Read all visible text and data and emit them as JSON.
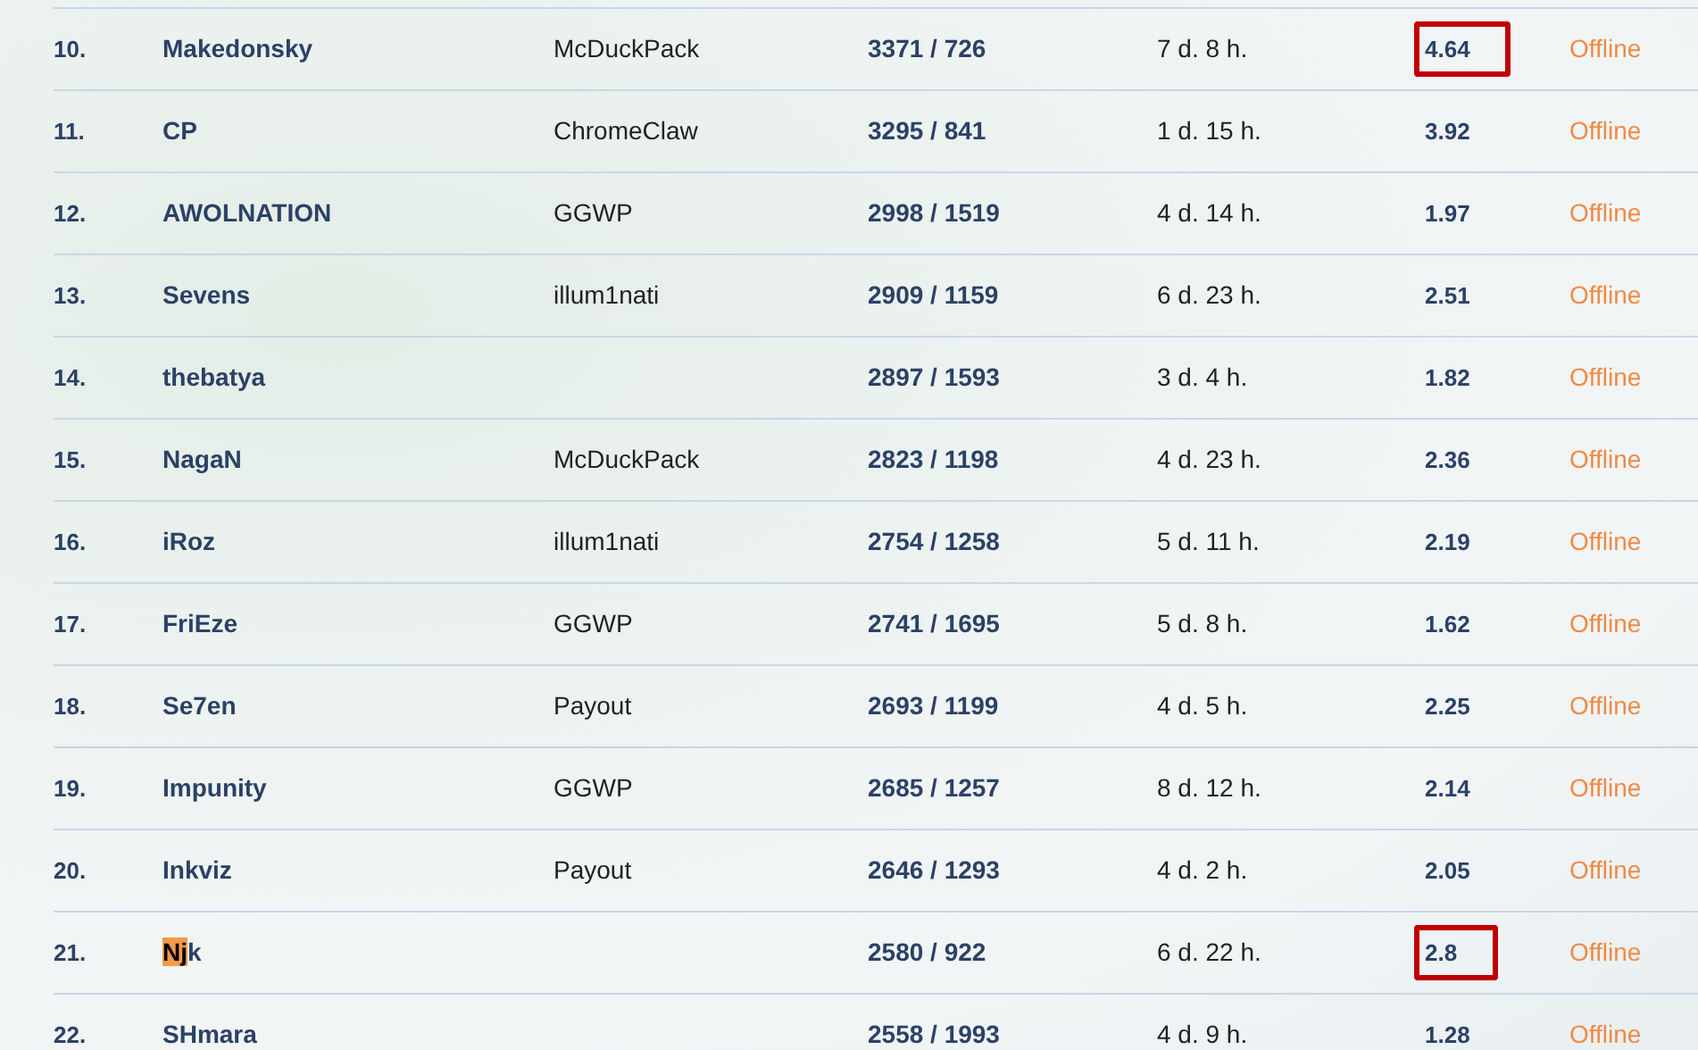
{
  "rows": [
    {
      "rank": "10.",
      "name": [
        {
          "text": "Makedonsky",
          "marked": false
        }
      ],
      "team": "McDuckPack",
      "score": "3371 / 726",
      "time": "7 d. 8 h.",
      "ratio": "4.64",
      "ratio_highlighted": true,
      "status": "Offline"
    },
    {
      "rank": "11.",
      "name": [
        {
          "text": "CP",
          "marked": false
        }
      ],
      "team": "ChromeClaw",
      "score": "3295 / 841",
      "time": "1 d. 15 h.",
      "ratio": "3.92",
      "ratio_highlighted": false,
      "status": "Offline"
    },
    {
      "rank": "12.",
      "name": [
        {
          "text": "AWOLNATION",
          "marked": false
        }
      ],
      "team": "GGWP",
      "score": "2998 / 1519",
      "time": "4 d. 14 h.",
      "ratio": "1.97",
      "ratio_highlighted": false,
      "status": "Offline"
    },
    {
      "rank": "13.",
      "name": [
        {
          "text": "Sevens",
          "marked": false
        }
      ],
      "team": "illum1nati",
      "score": "2909 / 1159",
      "time": "6 d. 23 h.",
      "ratio": "2.51",
      "ratio_highlighted": false,
      "status": "Offline"
    },
    {
      "rank": "14.",
      "name": [
        {
          "text": "thebatya",
          "marked": false
        }
      ],
      "score": "2897 / 1593",
      "time": "3 d. 4 h.",
      "ratio": "1.82",
      "ratio_highlighted": false,
      "status": "Offline"
    },
    {
      "rank": "15.",
      "name": [
        {
          "text": "NagaN",
          "marked": false
        }
      ],
      "team": "McDuckPack",
      "score": "2823 / 1198",
      "time": "4 d. 23 h.",
      "ratio": "2.36",
      "ratio_highlighted": false,
      "status": "Offline"
    },
    {
      "rank": "16.",
      "name": [
        {
          "text": "iRoz",
          "marked": false
        }
      ],
      "team": "illum1nati",
      "score": "2754 / 1258",
      "time": "5 d. 11 h.",
      "ratio": "2.19",
      "ratio_highlighted": false,
      "status": "Offline"
    },
    {
      "rank": "17.",
      "name": [
        {
          "text": "FriEze",
          "marked": false
        }
      ],
      "team": "GGWP",
      "score": "2741 / 1695",
      "time": "5 d. 8 h.",
      "ratio": "1.62",
      "ratio_highlighted": false,
      "status": "Offline"
    },
    {
      "rank": "18.",
      "name": [
        {
          "text": "Se7en",
          "marked": false
        }
      ],
      "team": "Payout",
      "score": "2693 / 1199",
      "time": "4 d. 5 h.",
      "ratio": "2.25",
      "ratio_highlighted": false,
      "status": "Offline"
    },
    {
      "rank": "19.",
      "name": [
        {
          "text": "Impunity",
          "marked": false
        }
      ],
      "team": "GGWP",
      "score": "2685 / 1257",
      "time": "8 d. 12 h.",
      "ratio": "2.14",
      "ratio_highlighted": false,
      "status": "Offline"
    },
    {
      "rank": "20.",
      "name": [
        {
          "text": "Inkviz",
          "marked": false
        }
      ],
      "team": "Payout",
      "score": "2646 / 1293",
      "time": "4 d. 2 h.",
      "ratio": "2.05",
      "ratio_highlighted": false,
      "status": "Offline"
    },
    {
      "rank": "21.",
      "name": [
        {
          "text": "Nj",
          "marked": true
        },
        {
          "text": "k",
          "marked": false
        }
      ],
      "score": "2580 / 922",
      "time": "6 d. 22 h.",
      "ratio": "2.8",
      "ratio_highlighted": true,
      "status": "Offline"
    },
    {
      "rank": "22.",
      "name": [
        {
          "text": "SHmara",
          "marked": false
        }
      ],
      "score": "2558 / 1993",
      "time": "4 d. 9 h.",
      "ratio": "1.28",
      "ratio_highlighted": false,
      "status": "Offline"
    }
  ]
}
